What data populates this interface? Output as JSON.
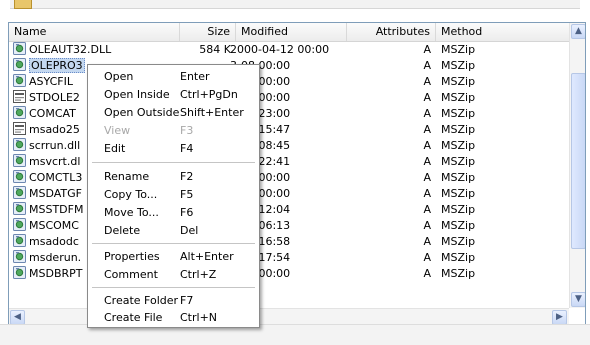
{
  "columns": {
    "name": "Name",
    "size": "Size",
    "modified": "Modified",
    "attributes": "Attributes",
    "method": "Method"
  },
  "files": [
    {
      "name": "OLEAUT32.DLL",
      "size": "584 K",
      "modified": "2000-04-12 00:00",
      "attributes": "A",
      "method": "MSZip",
      "icon": "dll-file-icon"
    },
    {
      "name": "OLEPRO3",
      "size": "",
      "modified": "3-08 00:00",
      "attributes": "A",
      "method": "MSZip",
      "icon": "dll-file-icon"
    },
    {
      "name": "ASYCFIL",
      "size": "",
      "modified": "3-08 00:00",
      "attributes": "A",
      "method": "MSZip",
      "icon": "dll-file-icon"
    },
    {
      "name": "STDOLE2",
      "size": "",
      "modified": "6-03 00:00",
      "attributes": "A",
      "method": "MSZip",
      "icon": "tlb-file-icon"
    },
    {
      "name": "COMCAT",
      "size": "",
      "modified": "5-30 23:00",
      "attributes": "A",
      "method": "MSZip",
      "icon": "dll-file-icon"
    },
    {
      "name": "msado25",
      "size": "",
      "modified": "7-11 15:47",
      "attributes": "A",
      "method": "MSZip",
      "icon": "tlb-file-icon"
    },
    {
      "name": "scrrun.dll",
      "size": "",
      "modified": "9-10 08:45",
      "attributes": "A",
      "method": "MSZip",
      "icon": "dll-file-icon"
    },
    {
      "name": "msvcrt.dl",
      "size": "",
      "modified": "8-28 22:41",
      "attributes": "A",
      "method": "MSZip",
      "icon": "dll-file-icon"
    },
    {
      "name": "COMCTL3",
      "size": "",
      "modified": "5-22 00:00",
      "attributes": "A",
      "method": "MSZip",
      "icon": "dll-file-icon"
    },
    {
      "name": "MSDATGF",
      "size": "",
      "modified": "2-06 00:00",
      "attributes": "A",
      "method": "MSZip",
      "icon": "dll-file-icon"
    },
    {
      "name": "MSSTDFM",
      "size": "",
      "modified": "3-14 12:04",
      "attributes": "A",
      "method": "MSZip",
      "icon": "dll-file-icon"
    },
    {
      "name": "MSCOMC",
      "size": "",
      "modified": "6-06 06:13",
      "attributes": "A",
      "method": "MSZip",
      "icon": "dll-file-icon"
    },
    {
      "name": "msadodc",
      "size": "",
      "modified": "5-22 16:58",
      "attributes": "A",
      "method": "MSZip",
      "icon": "dll-file-icon"
    },
    {
      "name": "msderun.",
      "size": "",
      "modified": "4-03 17:54",
      "attributes": "A",
      "method": "MSZip",
      "icon": "dll-file-icon"
    },
    {
      "name": "MSDBRPT",
      "size": "",
      "modified": "7-15 00:00",
      "attributes": "A",
      "method": "MSZip",
      "icon": "dll-file-icon"
    }
  ],
  "context_menu": {
    "open": {
      "label": "Open",
      "shortcut": "Enter"
    },
    "open_inside": {
      "label": "Open Inside",
      "shortcut": "Ctrl+PgDn"
    },
    "open_outside": {
      "label": "Open Outside",
      "shortcut": "Shift+Enter"
    },
    "view": {
      "label": "View",
      "shortcut": "F3"
    },
    "edit": {
      "label": "Edit",
      "shortcut": "F4"
    },
    "rename": {
      "label": "Rename",
      "shortcut": "F2"
    },
    "copy_to": {
      "label": "Copy To...",
      "shortcut": "F5"
    },
    "move_to": {
      "label": "Move To...",
      "shortcut": "F6"
    },
    "delete": {
      "label": "Delete",
      "shortcut": "Del"
    },
    "properties": {
      "label": "Properties",
      "shortcut": "Alt+Enter"
    },
    "comment": {
      "label": "Comment",
      "shortcut": "Ctrl+Z"
    },
    "create_folder": {
      "label": "Create Folder",
      "shortcut": "F7"
    },
    "create_file": {
      "label": "Create File",
      "shortcut": "Ctrl+N"
    }
  },
  "colors": {
    "selection": "#c4d8f0",
    "border": "#7f9db9",
    "disabled_text": "#a8a8a8"
  }
}
